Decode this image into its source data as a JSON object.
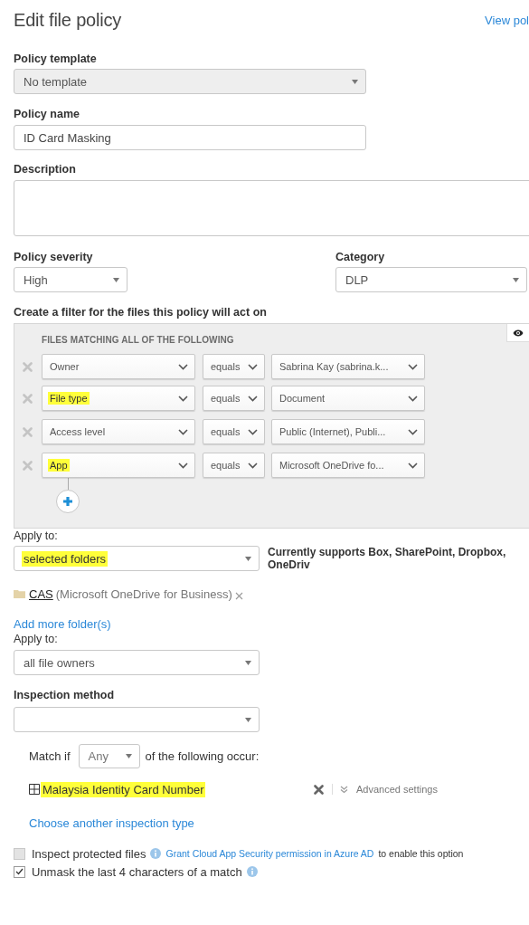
{
  "title": "Edit file policy",
  "header_link": "View pol",
  "policy_template": {
    "label": "Policy template",
    "value": "No template",
    "disabled": true
  },
  "policy_name": {
    "label": "Policy name",
    "value": "ID Card Masking"
  },
  "description": {
    "label": "Description"
  },
  "policy_severity": {
    "label": "Policy severity",
    "value": "High"
  },
  "category": {
    "label": "Category",
    "value": "DLP"
  },
  "filter": {
    "label": "Create a filter for the files this policy will act on",
    "heading": "FILES MATCHING ALL OF THE FOLLOWING",
    "rows": [
      {
        "field": "Owner",
        "field_highlighted": false,
        "operator": "equals",
        "value": "Sabrina Kay (sabrina.k..."
      },
      {
        "field": "File type",
        "field_highlighted": true,
        "operator": "equals",
        "value": "Document"
      },
      {
        "field": "Access level",
        "field_highlighted": false,
        "operator": "equals",
        "value": "Public (Internet), Publi..."
      },
      {
        "field": "App",
        "field_highlighted": true,
        "operator": "equals",
        "value": "Microsoft OneDrive fo..."
      }
    ]
  },
  "apply_to_folders": {
    "label": "Apply to:",
    "value": "selected folders",
    "highlighted": true,
    "note": "Currently supports Box, SharePoint, Dropbox, OneDriv",
    "folders": [
      {
        "name": "CAS",
        "app": "(Microsoft OneDrive for Business)"
      }
    ],
    "add_link": "Add more folder(s)"
  },
  "apply_to_owners": {
    "label": "Apply to:",
    "value": "all file owners"
  },
  "inspection": {
    "label": "Inspection method",
    "match_prefix": "Match if",
    "match_value": "Any",
    "match_suffix": "of the following occur:",
    "types": [
      {
        "name": "Malaysia Identity Card Number",
        "highlighted": true,
        "settings_link": "Advanced settings"
      }
    ],
    "choose_link": "Choose another inspection type"
  },
  "options": [
    {
      "label": "Inspect protected files",
      "checked": false,
      "disabled": true,
      "link": "Grant Cloud App Security permission in Azure AD",
      "suffix": "to enable this option"
    },
    {
      "label": "Unmask the last 4 characters of a match",
      "checked": true,
      "disabled": false
    }
  ]
}
